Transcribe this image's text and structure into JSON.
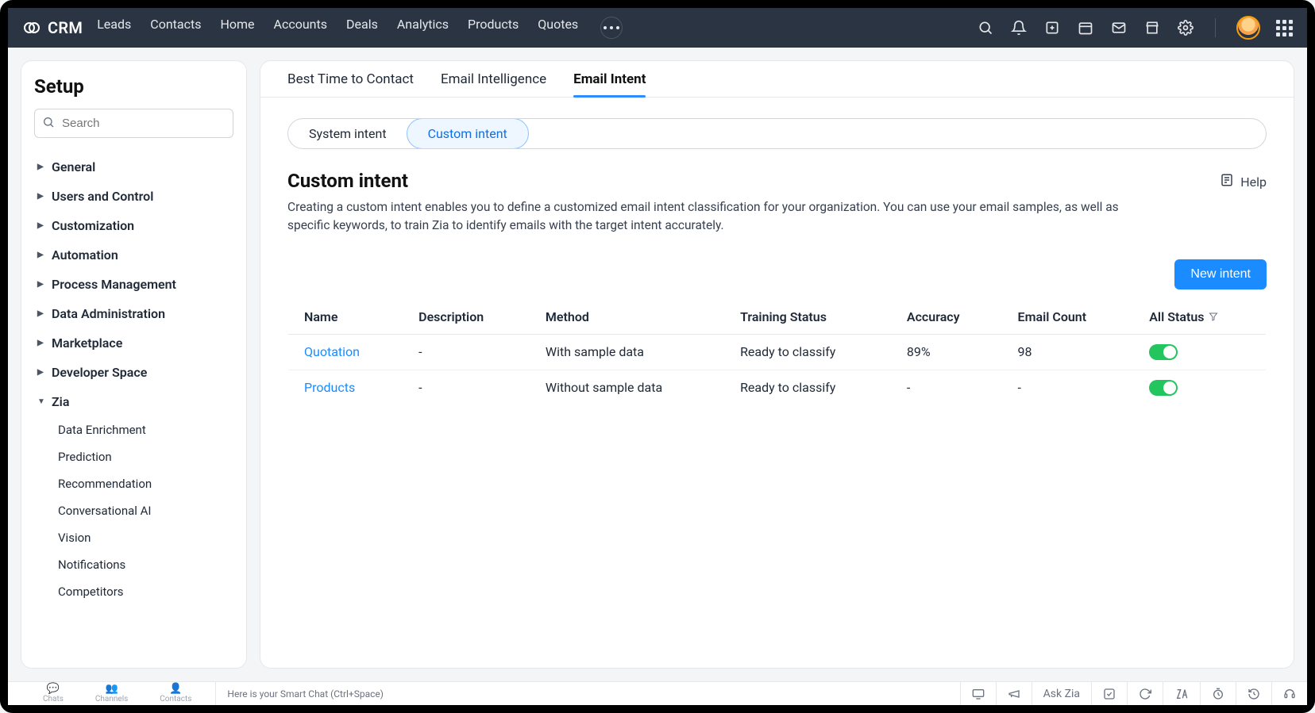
{
  "brand": "CRM",
  "nav": [
    "Leads",
    "Contacts",
    "Home",
    "Accounts",
    "Deals",
    "Analytics",
    "Products",
    "Quotes"
  ],
  "sidebar": {
    "title": "Setup",
    "search_placeholder": "Search",
    "groups": [
      "General",
      "Users and Control",
      "Customization",
      "Automation",
      "Process Management",
      "Data Administration",
      "Marketplace",
      "Developer Space"
    ],
    "zia_label": "Zia",
    "zia_items": [
      "Data Enrichment",
      "Prediction",
      "Recommendation",
      "Conversational AI",
      "Vision",
      "Notifications",
      "Competitors"
    ]
  },
  "tabs": [
    "Best Time to Contact",
    "Email Intelligence",
    "Email Intent"
  ],
  "active_tab": 2,
  "pills": {
    "system": "System intent",
    "custom": "Custom intent"
  },
  "section": {
    "title": "Custom intent",
    "desc": "Creating a custom intent enables you to define a customized email intent classification for your organization. You can use your email samples, as well as specific keywords, to train Zia to identify emails with the target intent accurately.",
    "help": "Help",
    "new_button": "New intent"
  },
  "columns": {
    "name": "Name",
    "description": "Description",
    "method": "Method",
    "training": "Training Status",
    "accuracy": "Accuracy",
    "emailcount": "Email Count",
    "status": "All Status"
  },
  "rows": [
    {
      "name": "Quotation",
      "description": "-",
      "method": "With sample data",
      "training": "Ready to classify",
      "accuracy": "89%",
      "emailcount": "98",
      "status": true
    },
    {
      "name": "Products",
      "description": "-",
      "method": "Without sample data",
      "training": "Ready to classify",
      "accuracy": "-",
      "emailcount": "-",
      "status": true
    }
  ],
  "bottom": {
    "items": [
      "Chats",
      "Channels",
      "Contacts"
    ],
    "prompt": "Here is your Smart Chat (Ctrl+Space)",
    "askzia": "Ask Zia"
  }
}
